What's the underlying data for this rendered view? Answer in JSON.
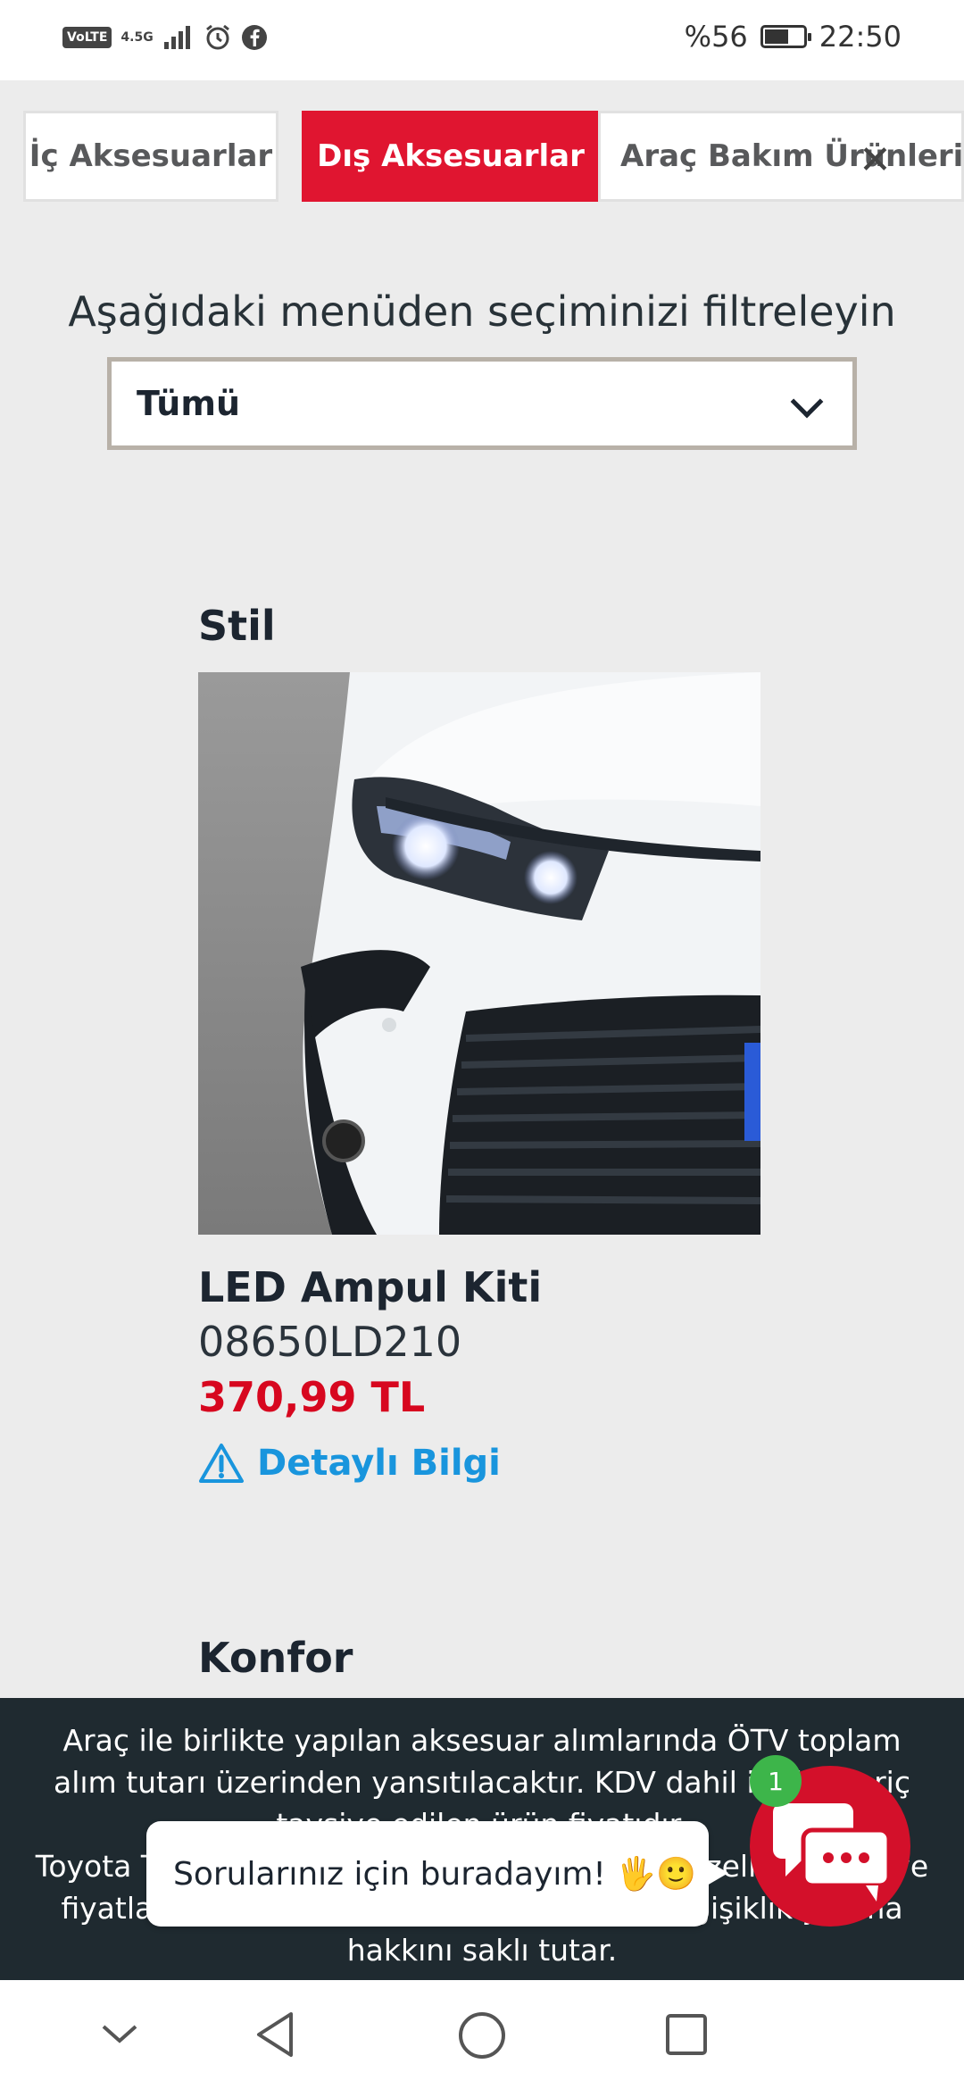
{
  "status_bar": {
    "volte": "VoLTE",
    "network": "4.5G",
    "battery": "%56",
    "time": "22:50"
  },
  "tabs": [
    {
      "label": "İç Aksesuarlar",
      "active": false
    },
    {
      "label": "Dış Aksesuarlar",
      "active": true
    },
    {
      "label": "Araç Bakım Ürünleri",
      "active": false
    }
  ],
  "filter": {
    "label": "Aşağıdaki menüden seçiminizi filtreleyin",
    "selected": "Tümü"
  },
  "sections": [
    {
      "title": "Stil",
      "product": {
        "name": "LED Ampul Kiti",
        "code": "08650LD210",
        "price": "370,99 TL",
        "detail_link": "Detaylı Bilgi"
      }
    },
    {
      "title": "Konfor"
    }
  ],
  "notice": {
    "line1": "Araç ile birlikte yapılan aksesuar alımlarında ÖTV toplam alım tutarı üzerinden yansıtılacaktır. KDV dahil işçilik hariç tavsiye edilen ürün fiyatıdır.",
    "line2": "Toyota Türkiye Pazarlama ve Satış A.Ş. ürün özelliklerinde ve fiyatlarında önceden haber vermeksizin değişiklik yapma hakkını saklı tutar."
  },
  "chat": {
    "bubble_text": "Sorularınız için buradayım! 🖐🙂",
    "badge": "1"
  },
  "colors": {
    "brand_red": "#e01530",
    "price_red": "#d7071f",
    "link_blue": "#1995dd",
    "notice_bg": "#1f2a30",
    "chat_red": "#d3102a",
    "badge_green": "#3db54a"
  }
}
